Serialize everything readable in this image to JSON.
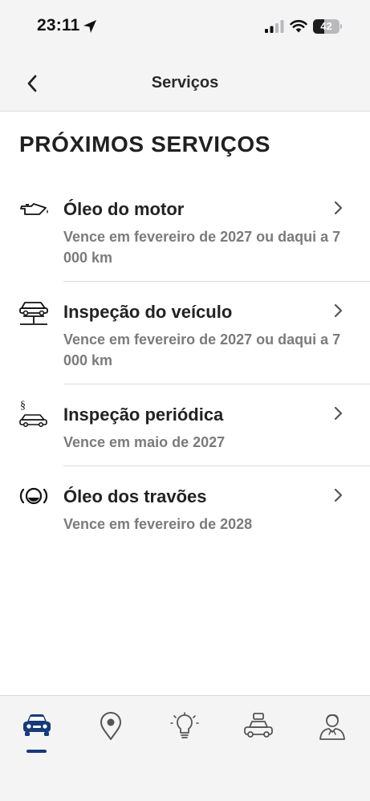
{
  "status_bar": {
    "time": "23:11",
    "battery_level": "42",
    "icons": [
      "location-arrow-icon",
      "cellular-signal-icon",
      "wifi-icon",
      "battery-icon"
    ]
  },
  "nav": {
    "title": "Serviços",
    "back_icon": "chevron-left-icon"
  },
  "section_title": "PRÓXIMOS SERVIÇOS",
  "services": [
    {
      "icon": "engine-oil-can-icon",
      "name": "Óleo do motor",
      "due": "Vence em fevereiro de 2027 ou daqui a 7 000 km"
    },
    {
      "icon": "car-lift-icon",
      "name": "Inspeção do veículo",
      "due": "Vence em fevereiro de 2027 ou daqui a 7 000 km"
    },
    {
      "icon": "car-inspection-paragraph-icon",
      "name": "Inspeção periódica",
      "due": "Vence em maio de 2027"
    },
    {
      "icon": "brake-fluid-icon",
      "name": "Óleo dos travões",
      "due": "Vence em fevereiro de 2028"
    }
  ],
  "tab_bar": {
    "active_index": 0,
    "tabs": [
      "car-icon",
      "map-pin-icon",
      "lightbulb-icon",
      "car-service-icon",
      "user-profile-icon"
    ]
  },
  "colors": {
    "accent": "#163a7a",
    "text_primary": "#222222",
    "text_secondary": "#7b7b7b",
    "bar_background": "#f4f4f5"
  }
}
